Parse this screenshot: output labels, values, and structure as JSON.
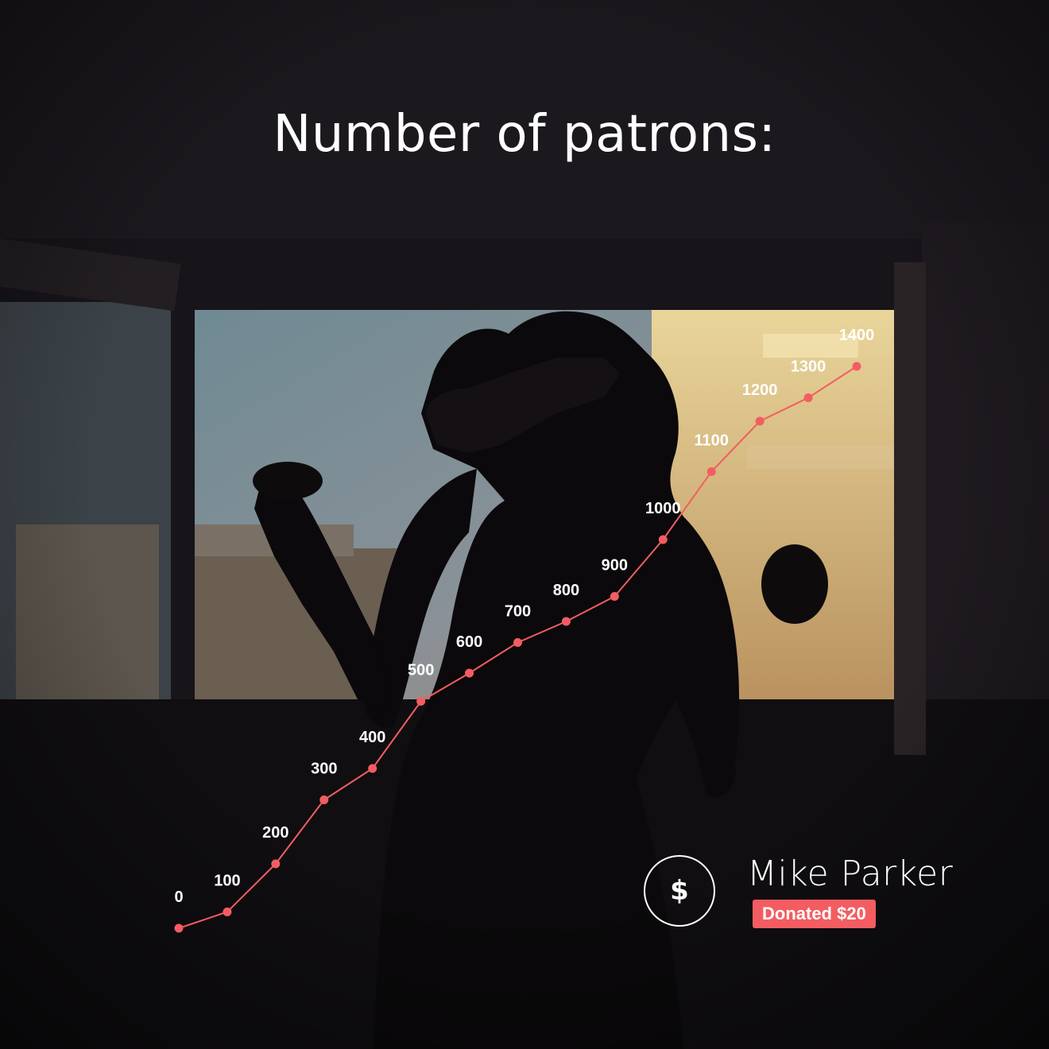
{
  "title": "Number of patrons:",
  "accent_color": "#f35d61",
  "chart_data": {
    "type": "line",
    "title": "Number of patrons:",
    "xlabel": "",
    "ylabel": "",
    "grid": false,
    "legend": "none",
    "ylim": [
      0,
      1400
    ],
    "series": [
      {
        "values": [
          0,
          100,
          200,
          300,
          400,
          500,
          600,
          700,
          800,
          900,
          1000,
          1100,
          1200,
          1300,
          1400
        ]
      }
    ],
    "data_labels": [
      "0",
      "100",
      "200",
      "300",
      "400",
      "500",
      "600",
      "700",
      "800",
      "900",
      "1000",
      "1100",
      "1200",
      "1300",
      "1400"
    ]
  },
  "donation": {
    "icon": "dollar-icon",
    "icon_glyph": "$",
    "name": "Mike Parker",
    "badge": "Donated $20"
  }
}
